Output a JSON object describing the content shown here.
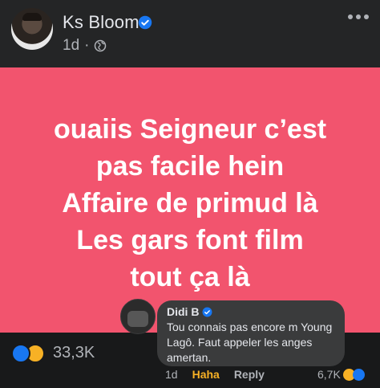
{
  "post": {
    "author": "Ks Bloom",
    "time": "1d",
    "privacy_icon": "globe-icon",
    "text_lines": [
      "ouaiis Seigneur c’est",
      "pas facile hein",
      "Affaire de primud là",
      "Les gars font film",
      "tout ça là"
    ],
    "background_color": "#f2546e",
    "reaction_count": "33,3K",
    "reactions": [
      "like",
      "haha"
    ]
  },
  "comment": {
    "author": "Didi B",
    "text": "Tou connais pas encore m Young Lagô. Faut appeler les anges amertan.",
    "time": "1d",
    "haha_label": "Haha",
    "reply_label": "Reply",
    "reaction_count": "6,7K"
  },
  "colors": {
    "accent_blue": "#1877f2",
    "haha_yellow": "#f7b125"
  }
}
